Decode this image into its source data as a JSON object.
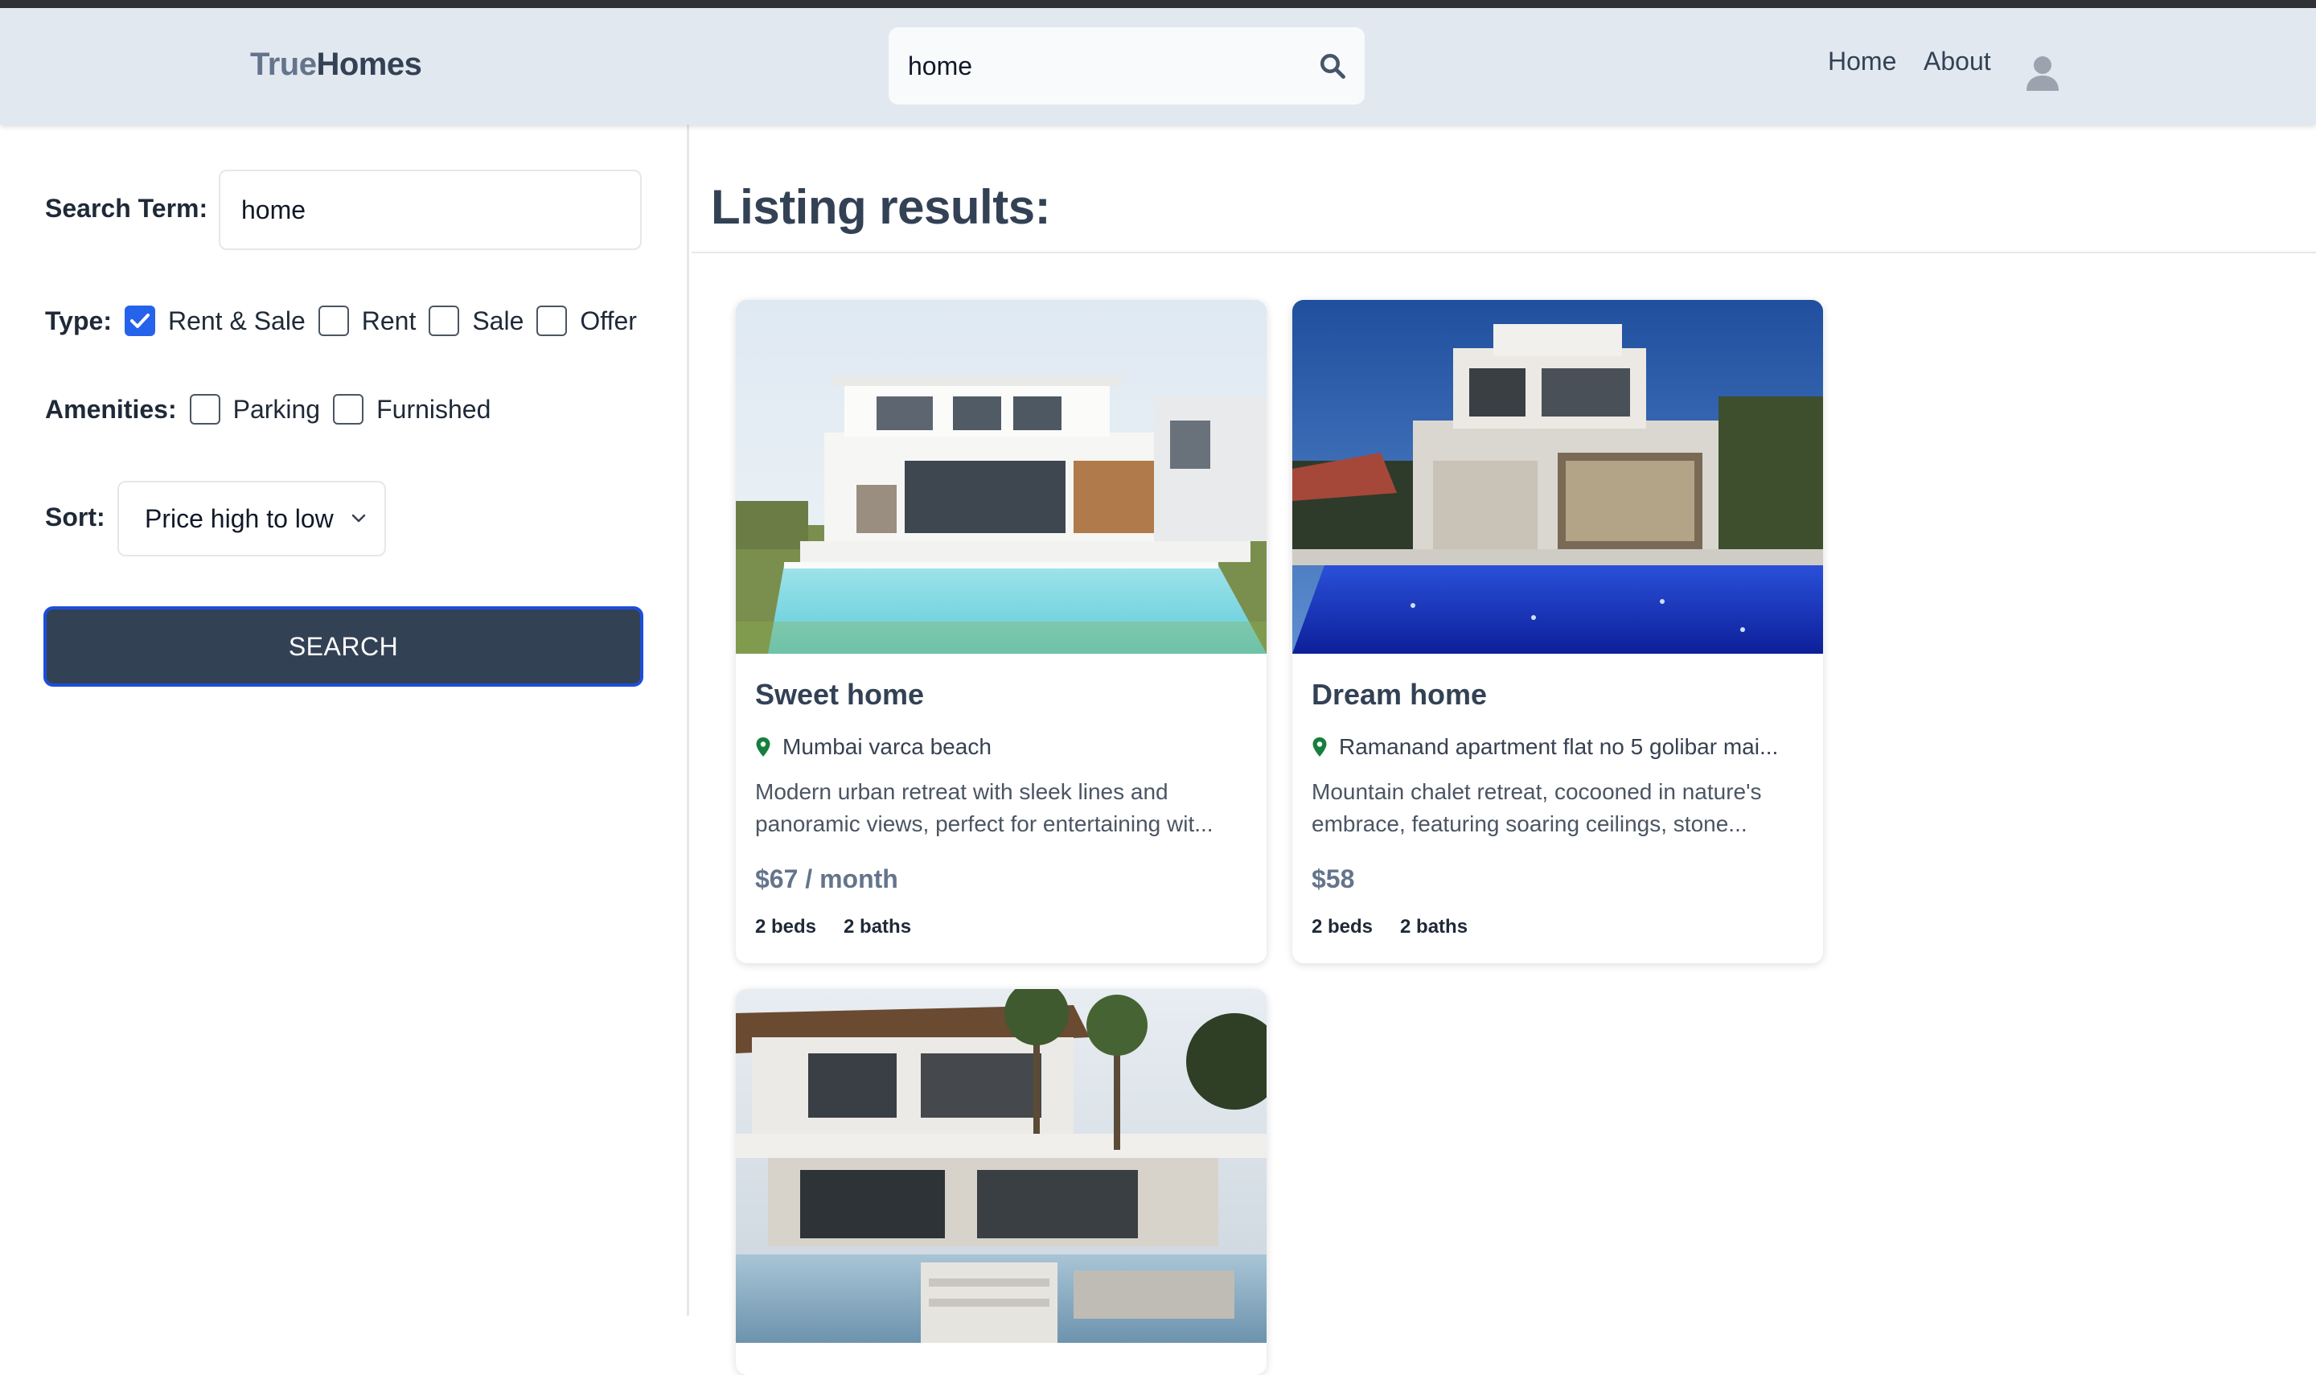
{
  "header": {
    "logo_part1": "True",
    "logo_part2": "Homes",
    "search_value": "home",
    "search_icon": "search-icon",
    "nav": [
      "Home",
      "About"
    ],
    "avatar_icon": "user-avatar-icon"
  },
  "filters": {
    "search_term_label": "Search Term:",
    "search_term_value": "home",
    "type_label": "Type:",
    "types": [
      {
        "label": "Rent & Sale",
        "checked": true
      },
      {
        "label": "Rent",
        "checked": false
      },
      {
        "label": "Sale",
        "checked": false
      },
      {
        "label": "Offer",
        "checked": false
      }
    ],
    "amenities_label": "Amenities:",
    "amenities": [
      {
        "label": "Parking",
        "checked": false
      },
      {
        "label": "Furnished",
        "checked": false
      }
    ],
    "sort_label": "Sort:",
    "sort_value": "Price high to low",
    "search_button": "SEARCH"
  },
  "results": {
    "title": "Listing results:",
    "listings": [
      {
        "title": "Sweet home",
        "location": "Mumbai varca beach",
        "description": "Modern urban retreat with sleek lines and panoramic views, perfect for entertaining wit...",
        "price": "$67 / month",
        "beds": "2 beds",
        "baths": "2 baths"
      },
      {
        "title": "Dream home",
        "location": "Ramanand apartment flat no 5 golibar mai...",
        "description": "Mountain chalet retreat, cocooned in nature's embrace, featuring soaring ceilings, stone...",
        "price": "$58",
        "beds": "2 beds",
        "baths": "2 baths"
      },
      {
        "title": "",
        "location": "",
        "description": "",
        "price": "",
        "beds": "",
        "baths": ""
      }
    ]
  },
  "colors": {
    "header_bg": "#e2e8f0",
    "button_bg": "#334155",
    "accent_blue": "#2563eb",
    "location_pin": "#15803d"
  }
}
